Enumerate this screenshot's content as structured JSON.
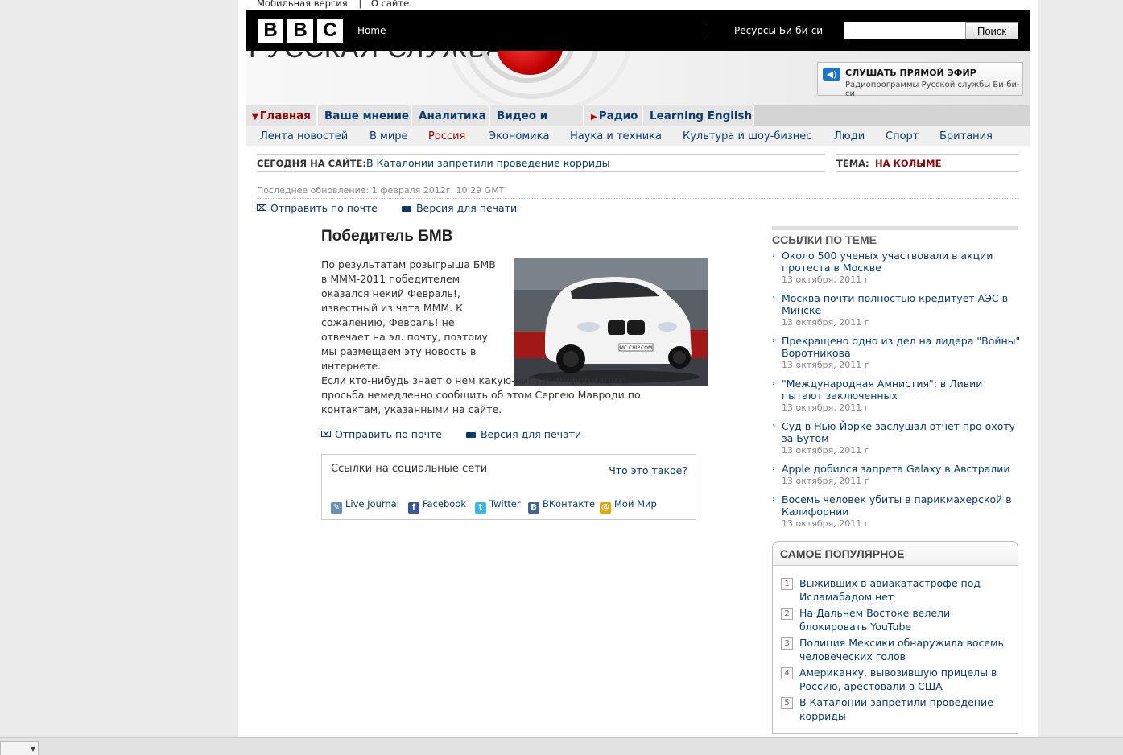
{
  "topbar": {
    "mobile_label": "Мобильная версия",
    "separator": "|",
    "about_label": "О сайте"
  },
  "header": {
    "logo_letters": [
      "B",
      "B",
      "C"
    ],
    "home_label": "Home",
    "resources_label": "Ресурсы Би-би-си",
    "search_button": "Поиск",
    "search_value": "",
    "service_title": "РУССКАЯ СЛУЖБА"
  },
  "live": {
    "title": "СЛУШАТЬ ПРЯМОЙ ЭФИР",
    "subtitle": "Радиопрограммы Русской службы Би-би-си",
    "icon": "speaker-icon"
  },
  "main_nav": [
    {
      "label": "Главная",
      "active": true,
      "marker": "▼"
    },
    {
      "label": "Ваше мнение"
    },
    {
      "label": "Аналитика"
    },
    {
      "label": "Видео и фото"
    },
    {
      "label": "Радио",
      "marker": "▶"
    },
    {
      "label": "Learning English"
    }
  ],
  "sub_nav": [
    {
      "label": "Лента новостей"
    },
    {
      "label": "В мире"
    },
    {
      "label": "Россия",
      "current": true
    },
    {
      "label": "Экономика"
    },
    {
      "label": "Наука и техника"
    },
    {
      "label": "Культура и шоу-бизнес"
    },
    {
      "label": "Люди"
    },
    {
      "label": "Спорт"
    },
    {
      "label": "Британия"
    }
  ],
  "today": {
    "label": "СЕГОДНЯ НА САЙТЕ:",
    "link": "В Каталонии запретили проведение корриды"
  },
  "tema": {
    "label": "ТЕМА:",
    "value": "НА КОЛЫМЕ"
  },
  "article": {
    "updated": "Последнее обновление: 1 февраля 2012г. 10:29 GMT",
    "send_mail": "Отправить по почте",
    "print_version": "Версия для печати",
    "headline": "Победитель БМВ",
    "paragraph1": "По результатам розыгрыша БМВ в МММ-2011 победителем оказался некий Февраль!, известный из чата МММ. К сожалению, Февраль! не отвечает на эл. почту, поэтому мы размещаем эту новость в интернете.",
    "paragraph2": "Если кто-нибудь знает о нем какую-нибудь информацию, просьба немедленно сообщить об этом Сергею Мавроди по контактам, указанными на сайте.",
    "plate_text": "MC CHIP.COM"
  },
  "social": {
    "title": "Ссылки на социальные сети",
    "what_is_it": "Что это такое?",
    "items": [
      {
        "label": "Live Journal",
        "icon": "livejournal-icon"
      },
      {
        "label": "Facebook",
        "icon": "facebook-icon"
      },
      {
        "label": "Twitter",
        "icon": "twitter-icon"
      },
      {
        "label": "ВКонтакте",
        "icon": "vkontakte-icon"
      },
      {
        "label": "Мой Мир",
        "icon": "moimir-icon"
      }
    ]
  },
  "related": {
    "title": "ССЫЛКИ ПО ТЕМЕ",
    "items": [
      {
        "title": "Около 500 ученых участвовали в акции протеста в Москве",
        "date": "13 октября, 2011 г"
      },
      {
        "title": "Москва почти полностью кредитует АЭС в Минске",
        "date": "13 октября, 2011 г"
      },
      {
        "title": "Прекращено одно из дел на лидера \"Войны\" Воротникова",
        "date": "13 октября, 2011 г"
      },
      {
        "title": "\"Международная Амнистия\": в Ливии пытают заключенных",
        "date": "13 октября, 2011 г"
      },
      {
        "title": "Суд в Нью-Йорке заслушал отчет про охоту за Бутом",
        "date": "13 октября, 2011 г"
      },
      {
        "title": "Apple добился запрета Galaxy в Австралии",
        "date": "13 октября, 2011 г"
      },
      {
        "title": "Восемь человек убиты в парикмахерской в Калифорнии",
        "date": "13 октября, 2011 г"
      }
    ]
  },
  "popular": {
    "title": "САМОЕ ПОПУЛЯРНОЕ",
    "items": [
      {
        "num": "1",
        "title": "Выживших в авиакатастрофе под Исламабадом нет"
      },
      {
        "num": "2",
        "title": "На Дальнем Востоке велели блокировать YouTube"
      },
      {
        "num": "3",
        "title": "Полиция Мексики обнаружила восемь человеческих голов"
      },
      {
        "num": "4",
        "title": "Американку, вывозившую прицелы в Россию, арестовали в США"
      },
      {
        "num": "5",
        "title": "В Каталонии запретили проведение корриды"
      }
    ]
  },
  "colors": {
    "brand_dark": "#000000",
    "link": "#0b3b6b",
    "accent_red": "#8a0000"
  }
}
